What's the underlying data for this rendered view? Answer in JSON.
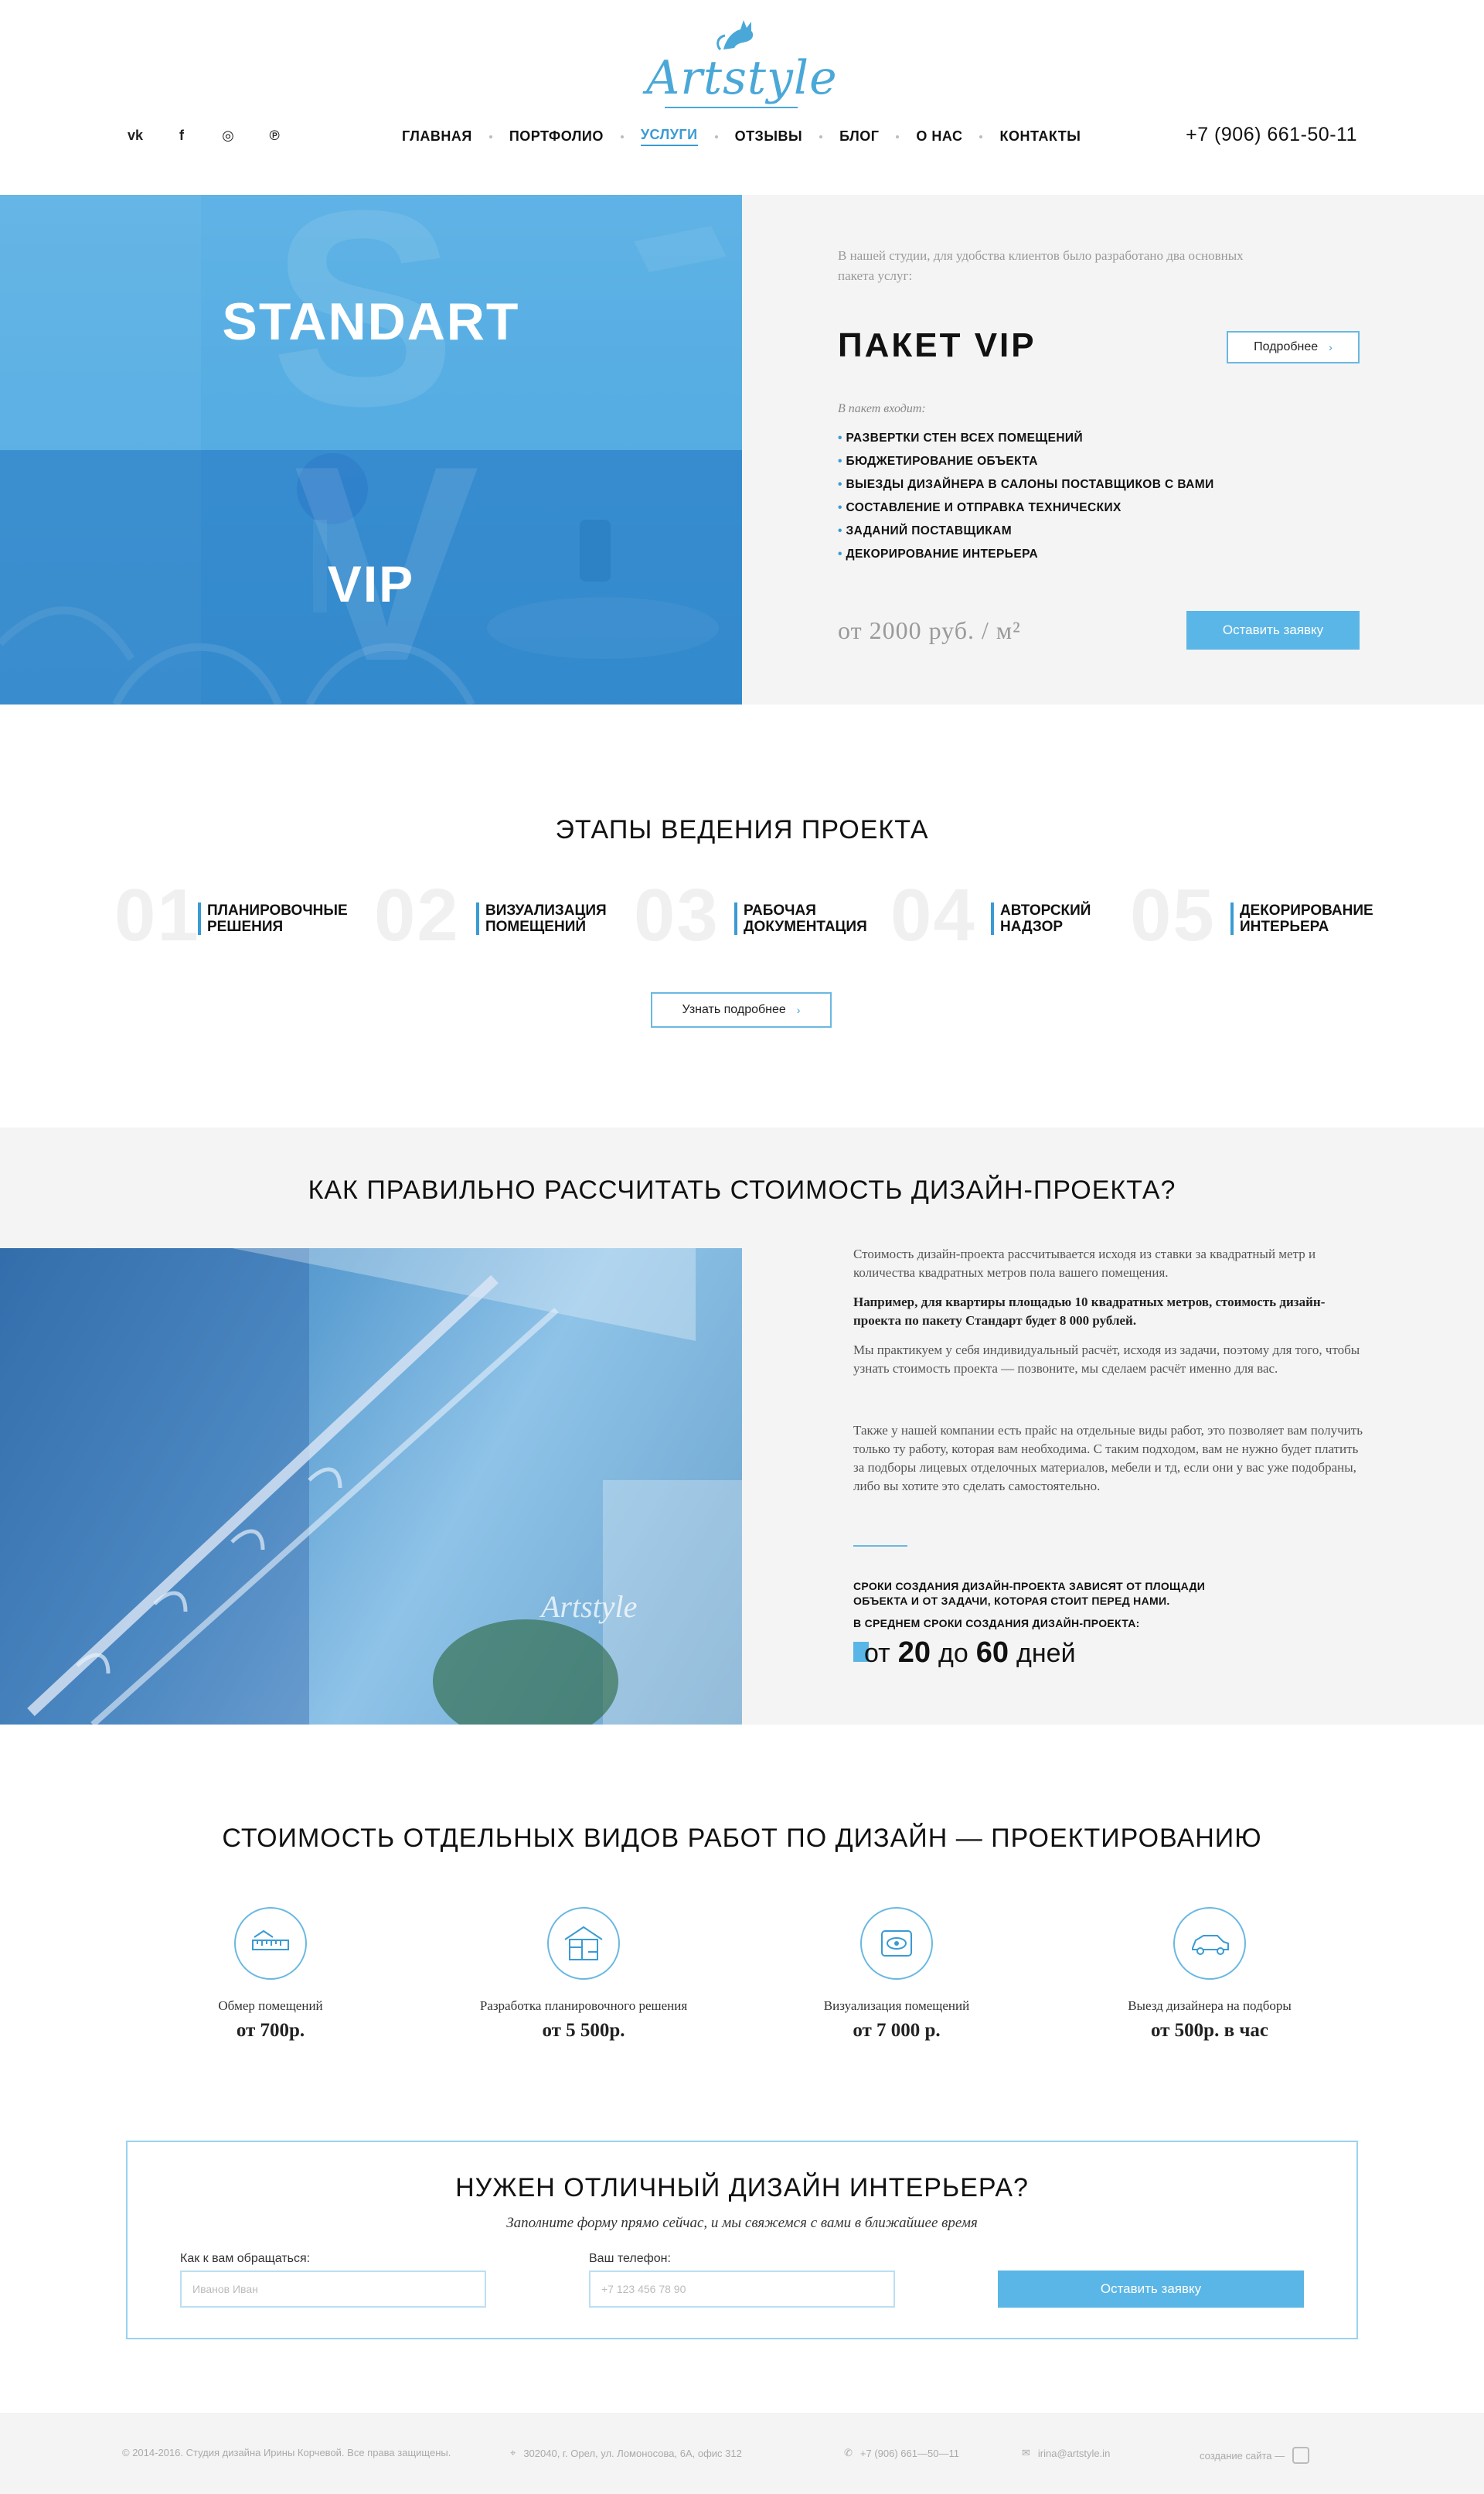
{
  "header": {
    "logo_text": "Artstyle",
    "social": [
      {
        "icon": "vk-icon",
        "glyph": "vk"
      },
      {
        "icon": "facebook-icon",
        "glyph": "f"
      },
      {
        "icon": "instagram-icon",
        "glyph": "◎"
      },
      {
        "icon": "pinterest-icon",
        "glyph": "℗"
      }
    ],
    "nav": [
      "ГЛАВНАЯ",
      "ПОРТФОЛИО",
      "УСЛУГИ",
      "ОТЗЫВЫ",
      "БЛОГ",
      "О НАС",
      "КОНТАКТЫ"
    ],
    "nav_active": "УСЛУГИ",
    "phone": "+7 (906) 661-50-11"
  },
  "hero": {
    "standart_label": "STANDART",
    "vip_label": "VIP",
    "intro": "В нашей студии, для удобства клиентов было разработано два основных пакета услуг:",
    "package_title": "ПАКЕТ VIP",
    "more_button": "Подробнее",
    "includes_label": "В пакет входит:",
    "includes": [
      "РАЗВЕРТКИ СТЕН ВСЕХ ПОМЕЩЕНИЙ",
      "БЮДЖЕТИРОВАНИЕ ОБЪЕКТА",
      "ВЫЕЗДЫ ДИЗАЙНЕРА В САЛОНЫ ПОСТАВЩИКОВ С ВАМИ",
      "СОСТАВЛЕНИЕ И ОТПРАВКА ТЕХНИЧЕСКИХ",
      "ЗАДАНИЙ ПОСТАВЩИКАМ",
      "ДЕКОРИРОВАНИЕ ИНТЕРЬЕРА"
    ],
    "price": "от 2000 руб. / м²",
    "order_button": "Оставить заявку"
  },
  "stages": {
    "title": "ЭТАПЫ ВЕДЕНИЯ ПРОЕКТА",
    "items": [
      {
        "num": "01",
        "label": "ПЛАНИРОВОЧНЫЕ РЕШЕНИЯ"
      },
      {
        "num": "02",
        "label": "ВИЗУАЛИЗАЦИЯ ПОМЕЩЕНИЙ"
      },
      {
        "num": "03",
        "label": "РАБОЧАЯ ДОКУМЕНТАЦИЯ"
      },
      {
        "num": "04",
        "label": "АВТОРСКИЙ НАДЗОР"
      },
      {
        "num": "05",
        "label": "ДЕКОРИРОВАНИЕ ИНТЕРЬЕРА"
      }
    ],
    "more_button": "Узнать подробнее"
  },
  "calc": {
    "title": "КАК ПРАВИЛЬНО РАССЧИТАТЬ СТОИМОСТЬ ДИЗАЙН-ПРОЕКТА?",
    "image_watermark": "Artstyle",
    "p1": "Стоимость дизайн-проекта рассчитывается исходя из ставки за квадратный метр и количества квадратных метров пола вашего помещения.",
    "p2": "Например, для квартиры площадью 10 квадратных метров, стоимость дизайн-проекта по пакету Стандарт будет 8 000 рублей.",
    "p3": "Мы практикуем у себя индивидуальный расчёт, исходя из задачи, поэтому для того, чтобы узнать стоимость проекта — позвоните, мы сделаем расчёт именно для вас.",
    "p4": "Также у нашей компании есть прайс на отдельные виды работ, это позволяет вам получить только ту работу, которая вам необходима. С таким подходом, вам не нужно будет платить за подборы лицевых отделочных материалов, мебели и тд, если они у вас уже подобраны, либо вы хотите это сделать самостоятельно.",
    "terms": "СРОКИ СОЗДАНИЯ ДИЗАЙН-ПРОЕКТА ЗАВИСЯТ ОТ ПЛОЩАДИ ОБЪЕКТА И ОТ ЗАДАЧИ, КОТОРАЯ СТОИТ ПЕРЕД НАМИ.",
    "avg_label": "В СРЕДНЕМ СРОКИ СОЗДАНИЯ ДИЗАЙН-ПРОЕКТА:",
    "days_from": "от",
    "days_min": "20",
    "days_to": "до",
    "days_max": "60",
    "days_unit": "дней"
  },
  "prices": {
    "title": "СТОИМОСТЬ ОТДЕЛЬНЫХ ВИДОВ РАБОТ ПО ДИЗАЙН — ПРОЕКТИРОВАНИЮ",
    "items": [
      {
        "icon": "ruler-icon",
        "label": "Обмер помещений",
        "price": "от 700р."
      },
      {
        "icon": "floorplan-icon",
        "label": "Разработка планировочного решения",
        "price": "от 5 500р."
      },
      {
        "icon": "eye-icon",
        "label": "Визуализация помещений",
        "price": "от 7 000 р."
      },
      {
        "icon": "car-icon",
        "label": "Выезд дизайнера на подборы",
        "price": "от 500р. в час"
      }
    ]
  },
  "form": {
    "title": "НУЖЕН ОТЛИЧНЫЙ ДИЗАЙН ИНТЕРЬЕРА?",
    "subtitle": "Заполните форму прямо сейчас, и мы свяжемся с вами в ближайшее время",
    "name_label": "Как к вам обращаться:",
    "name_placeholder": "Иванов Иван",
    "phone_label": "Ваш телефон:",
    "phone_placeholder": "+7 123 456 78 90",
    "submit": "Оставить заявку"
  },
  "footer": {
    "copyright": "© 2014-2016. Студия дизайна Ирины Корчевой. Все права защищены.",
    "address": "302040, г. Орел, ул. Ломоносова, 6А, офис 312",
    "phone": "+7 (906) 661—50—11",
    "email": "irina@artstyle.in",
    "made_by": "создание сайта —"
  },
  "colors": {
    "accent": "#3a9bd3",
    "accent_light": "#5ab6e6",
    "bg_gray": "#f4f4f4"
  }
}
